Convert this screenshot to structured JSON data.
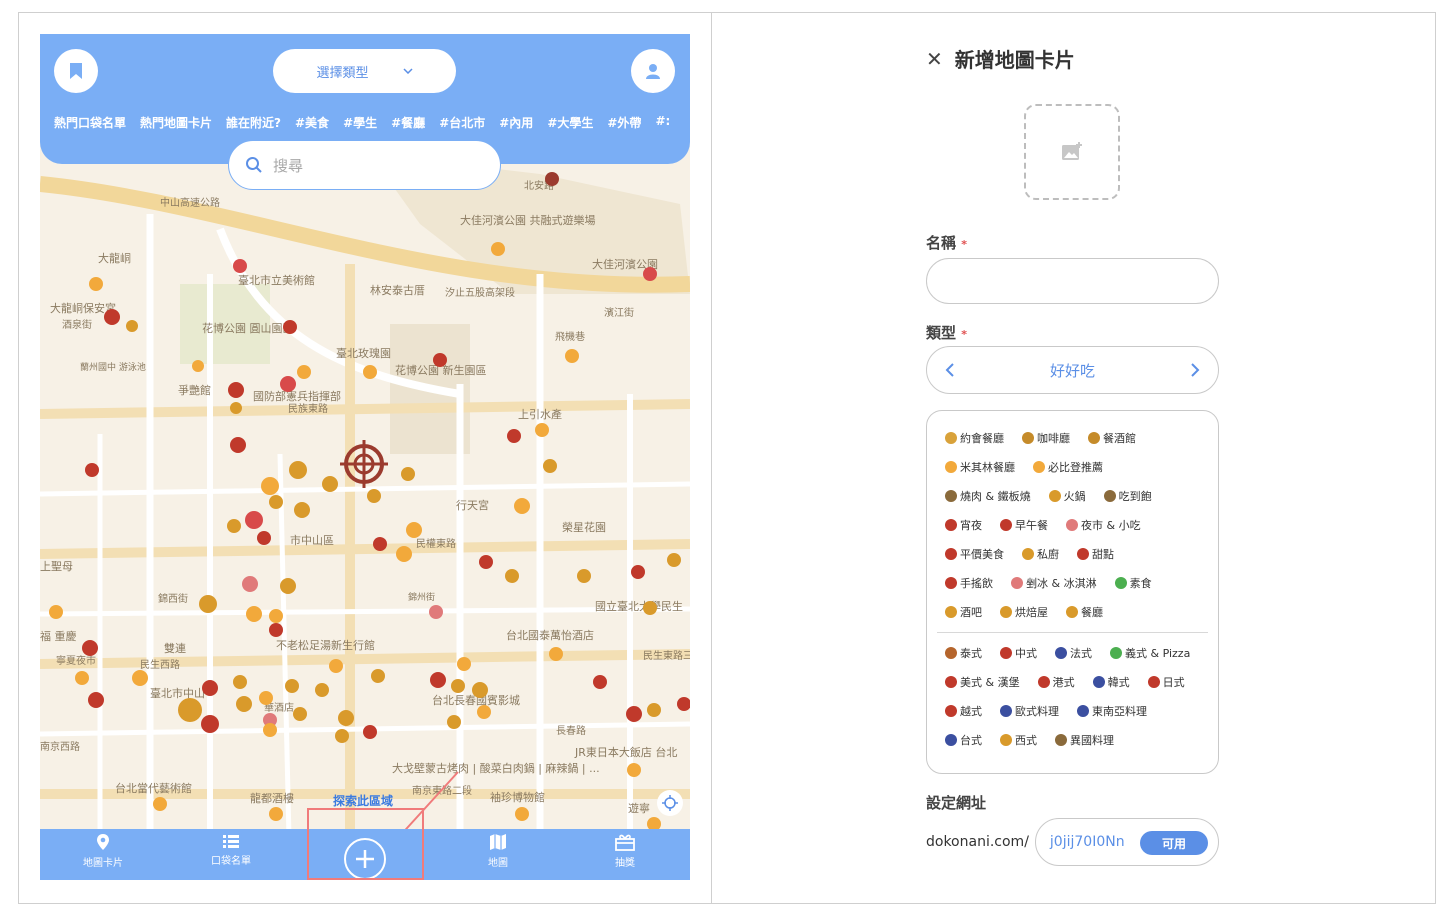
{
  "map_screen": {
    "type_select": "選擇類型",
    "tags": [
      "熱門口袋名單",
      "熱門地圖卡片",
      "誰在附近?",
      "#美食",
      "#學生",
      "#餐廳",
      "#台北市",
      "#內用",
      "#大學生",
      "#外帶",
      "#:"
    ],
    "search_placeholder": "搜尋",
    "explore_label": "探索此區域",
    "map_labels": [
      "中山高速公路",
      "大佳河濱公園 共融式遊樂場",
      "大佳河濱公園",
      "北安路",
      "大龍峒",
      "臺北市立美術館",
      "林安泰古厝",
      "汐止五股高架段",
      "大龍峒保安宮",
      "酒泉街",
      "花博公園 圓山園區",
      "濱江街",
      "飛機巷",
      "臺北玫瑰園",
      "花博公園 新生園區",
      "蘭州國中 游泳池",
      "爭艷館",
      "國防部憲兵指揮部",
      "民族東路",
      "上引水產",
      "市中山區",
      "民權東路",
      "行天宮",
      "榮星花園",
      "上聖母",
      "錦西街",
      "不老松足湯新生行館",
      "福 重慶",
      "寧夏夜市",
      "雙連",
      "民生西路",
      "臺北市中山",
      "錦州街",
      "台北國泰萬怡酒店",
      "民生東路三",
      "台北長春國賓影城",
      "長春路",
      "華酒店",
      "南京西路",
      "大戈壁蒙古烤肉 | 酸菜白肉鍋 | 麻辣鍋 | ...",
      "JR東日本大飯店 台北",
      "台北當代藝術館",
      "龍都酒樓",
      "南京東路二段",
      "袖珍博物館",
      "國立臺北大學民生",
      "遊寧"
    ]
  },
  "bottom_nav": {
    "items": [
      {
        "label": "地圖卡片",
        "icon": "map-pin-icon"
      },
      {
        "label": "口袋名單",
        "icon": "list-icon"
      },
      {
        "label": "地圖",
        "icon": "map-icon"
      },
      {
        "label": "抽獎",
        "icon": "gift-icon"
      }
    ]
  },
  "form": {
    "title": "新增地圖卡片",
    "name_label": "名稱",
    "type_label": "類型",
    "required_mark": "*",
    "type_value": "好好吃",
    "categories_group1": [
      [
        {
          "label": "約會餐廳",
          "color": "#d9a23a"
        },
        {
          "label": "咖啡廳",
          "color": "#c58b2a"
        },
        {
          "label": "餐酒館",
          "color": "#c58b2a"
        }
      ],
      [
        {
          "label": "米其林餐廳",
          "color": "#f2a93b"
        },
        {
          "label": "必比登推薦",
          "color": "#f2a93b"
        }
      ],
      [
        {
          "label": "燒肉 & 鐵板燒",
          "color": "#8a6a3b"
        },
        {
          "label": "火鍋",
          "color": "#d99a2b"
        },
        {
          "label": "吃到飽",
          "color": "#8a6a3b"
        }
      ],
      [
        {
          "label": "宵夜",
          "color": "#c0392b"
        },
        {
          "label": "早午餐",
          "color": "#c0392b"
        },
        {
          "label": "夜市 & 小吃",
          "color": "#e07a7a"
        }
      ],
      [
        {
          "label": "平價美食",
          "color": "#c0392b"
        },
        {
          "label": "私廚",
          "color": "#d99a2b"
        },
        {
          "label": "甜點",
          "color": "#c0392b"
        }
      ],
      [
        {
          "label": "手搖飲",
          "color": "#c0392b"
        },
        {
          "label": "剉冰 & 冰淇淋",
          "color": "#e07a7a"
        },
        {
          "label": "素食",
          "color": "#4caf50"
        }
      ],
      [
        {
          "label": "酒吧",
          "color": "#d99a2b"
        },
        {
          "label": "烘焙屋",
          "color": "#d99a2b"
        },
        {
          "label": "餐廳",
          "color": "#d99a2b"
        }
      ]
    ],
    "categories_group2": [
      [
        {
          "label": "泰式",
          "color": "#b5652c"
        },
        {
          "label": "中式",
          "color": "#c0392b"
        },
        {
          "label": "法式",
          "color": "#3b4fa0"
        },
        {
          "label": "義式 & Pizza",
          "color": "#4caf50"
        }
      ],
      [
        {
          "label": "美式 & 漢堡",
          "color": "#c0392b"
        },
        {
          "label": "港式",
          "color": "#c0392b"
        },
        {
          "label": "韓式",
          "color": "#3b4fa0"
        },
        {
          "label": "日式",
          "color": "#c0392b"
        }
      ],
      [
        {
          "label": "越式",
          "color": "#c0392b"
        },
        {
          "label": "歐式料理",
          "color": "#3b4fa0"
        },
        {
          "label": "東南亞料理",
          "color": "#3b4fa0"
        }
      ],
      [
        {
          "label": "台式",
          "color": "#3b4fa0"
        },
        {
          "label": "西式",
          "color": "#d99a2b"
        },
        {
          "label": "異國料理",
          "color": "#8a6a3b"
        }
      ]
    ],
    "url_label": "設定網址",
    "url_prefix": "dokonani.com/",
    "url_value": "j0jij70I0Nn",
    "url_status": "可用"
  },
  "colors": {
    "brand_blue": "#7aaef5",
    "accent_blue": "#5b8fe6",
    "highlight_red": "#f07b7b"
  }
}
